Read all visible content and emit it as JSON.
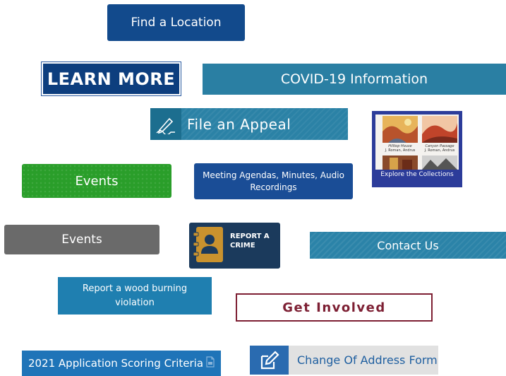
{
  "buttons": {
    "find_location": "Find a Location",
    "learn_more": "LEARN MORE",
    "covid": "COVID-19 Information",
    "file_appeal": "File an Appeal",
    "explore": {
      "label": "Explore the Collections",
      "thumb1_title": "Hilltop House",
      "thumb1_artist": "J. Roman, Andrus",
      "thumb2_title": "Canyon Passage",
      "thumb2_artist": "J. Roman, Andrus"
    },
    "events_green": "Events",
    "meeting": "Meeting Agendas, Minutes, Audio Recordings",
    "events_gray": "Events",
    "report_crime": {
      "line1": "REPORT A",
      "line2": "CRIME"
    },
    "contact": "Contact Us",
    "wood_burning": "Report a wood burning violation",
    "get_involved": "Get Involved",
    "scoring": "2021 Application Scoring Criteria",
    "change_address": "Change Of Address Form"
  },
  "icons": {
    "appeal": "pen-signature-icon",
    "crime": "address-book-icon",
    "pdf": "pdf-file-icon",
    "address": "edit-pencil-icon"
  }
}
